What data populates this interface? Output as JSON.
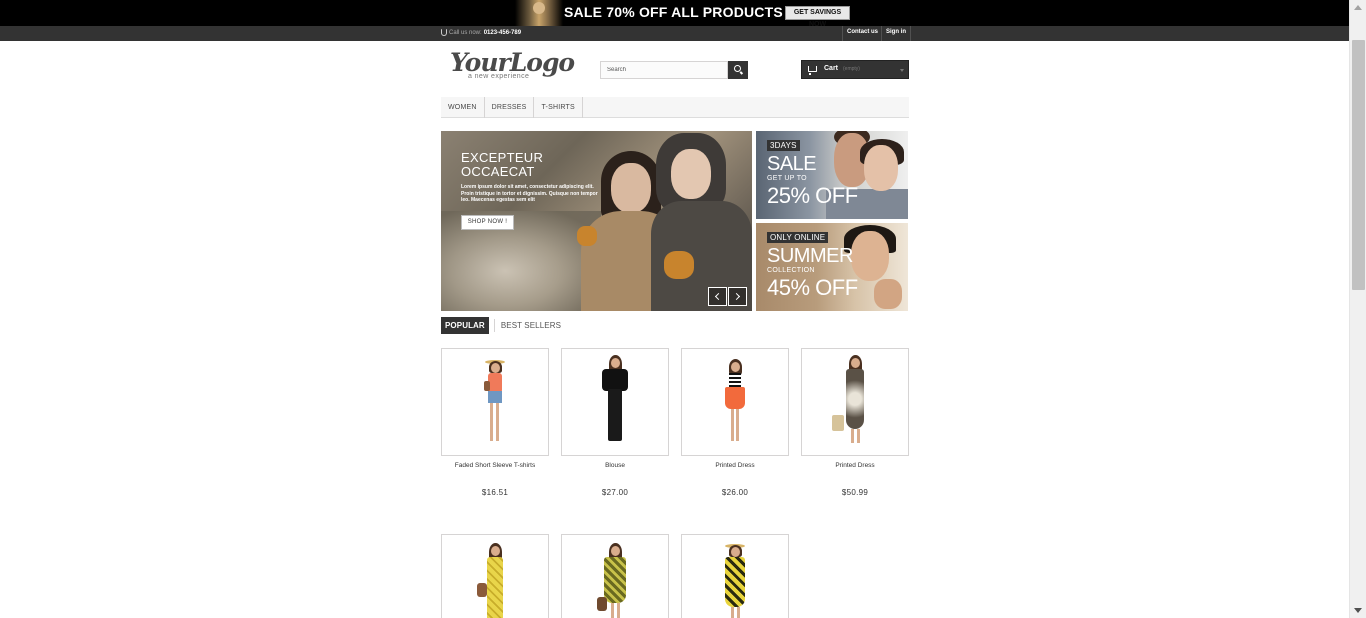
{
  "banner": {
    "text": "SALE 70% OFF ALL PRODUCTS",
    "button": "GET SAVINGS NOW"
  },
  "topbar": {
    "call_label": "Call us now:",
    "phone": "0123-456-789",
    "contact": "Contact us",
    "signin": "Sign in"
  },
  "logo": {
    "main": "YourLogo",
    "tagline": "a new experience"
  },
  "search": {
    "placeholder": "Search"
  },
  "cart": {
    "label": "Cart",
    "status": "(empty)"
  },
  "menu": {
    "items": [
      "WOMEN",
      "DRESSES",
      "T-SHIRTS"
    ]
  },
  "slider": {
    "heading_line1": "EXCEPTEUR",
    "heading_line2": "OCCAECAT",
    "body": "Lorem ipsum dolor sit amet, consectetur adipiscing elit. Proin tristique in tortor et dignissim. Quisque non tempor leo. Maecenas egestas sem elit",
    "button": "SHOP NOW !"
  },
  "promos": [
    {
      "tag": "3DAYS",
      "big": "SALE",
      "small": "GET UP TO",
      "off": "25% OFF"
    },
    {
      "tag": "ONLY ONLINE",
      "big": "SUMMER",
      "small": "COLLECTION",
      "off": "45% OFF"
    }
  ],
  "tabs": {
    "popular": "POPULAR",
    "best_sellers": "BEST SELLERS"
  },
  "products": [
    {
      "name": "Faded Short Sleeve T-shirts",
      "price": "$16.51"
    },
    {
      "name": "Blouse",
      "price": "$27.00"
    },
    {
      "name": "Printed Dress",
      "price": "$26.00"
    },
    {
      "name": "Printed Dress",
      "price": "$50.99"
    },
    {
      "name": "",
      "price": ""
    },
    {
      "name": "",
      "price": ""
    },
    {
      "name": "",
      "price": ""
    }
  ],
  "colors": {
    "dark": "#333333",
    "banner_bg": "#000000",
    "border": "#d6d4d4"
  }
}
